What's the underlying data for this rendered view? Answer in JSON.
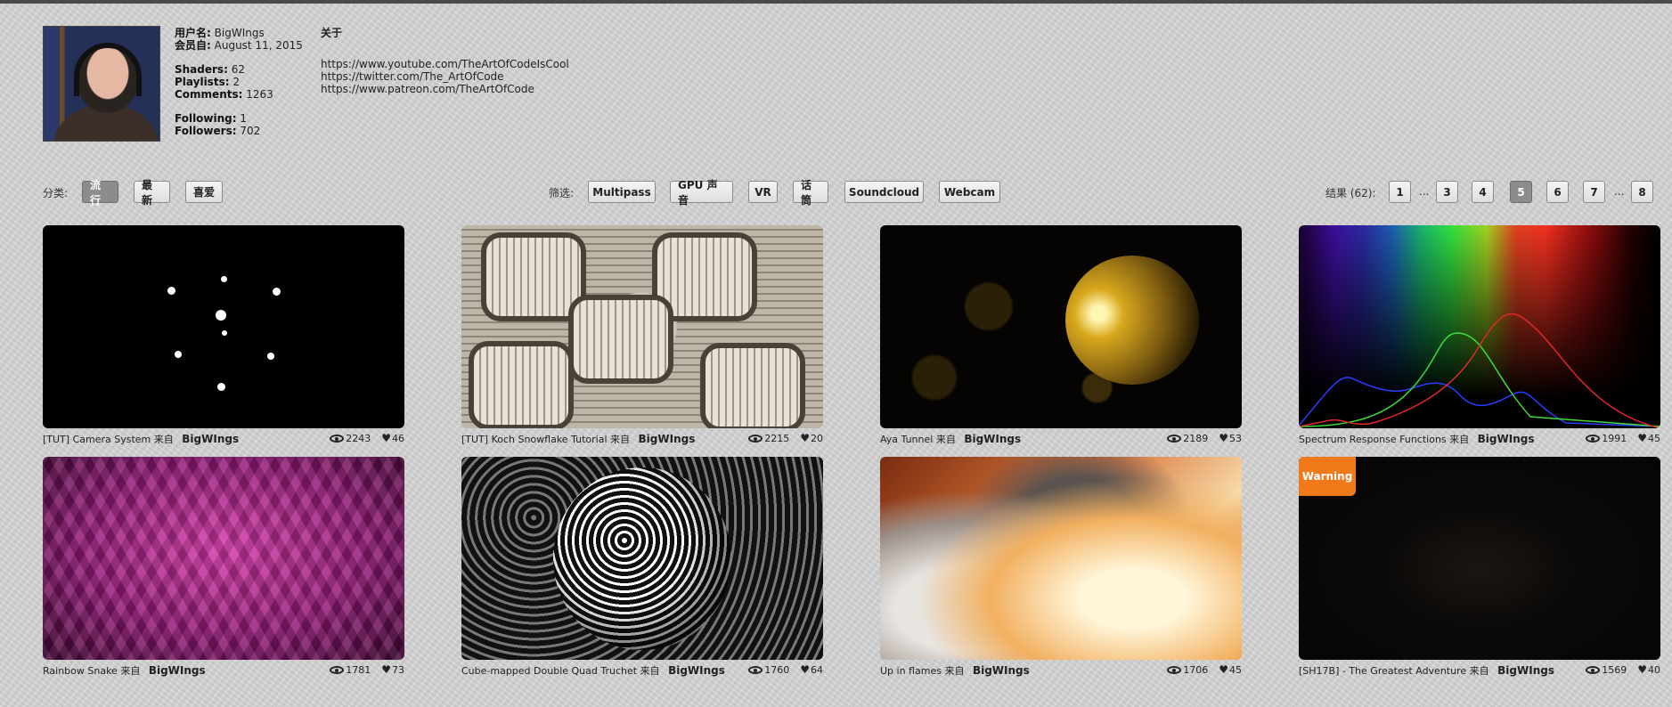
{
  "profile": {
    "username_label": "用户名:",
    "username": "BigWIngs",
    "member_label": "会员自:",
    "member_since": "August 11, 2015",
    "shaders_label": "Shaders:",
    "shaders": "62",
    "playlists_label": "Playlists:",
    "playlists": "2",
    "comments_label": "Comments:",
    "comments": "1263",
    "following_label": "Following:",
    "following": "1",
    "followers_label": "Followers:",
    "followers": "702"
  },
  "about": {
    "title": "关于",
    "links": [
      "https://www.youtube.com/TheArtOfCodeIsCool",
      "https://twitter.com/The_ArtOfCode",
      "https://www.patreon.com/TheArtOfCode"
    ]
  },
  "sort": {
    "label": "分类:",
    "options": [
      "流行",
      "最新",
      "喜爱"
    ],
    "active": "流行"
  },
  "filter": {
    "label": "筛选:",
    "options": [
      "Multipass",
      "GPU 声音",
      "VR",
      "话筒",
      "Soundcloud",
      "Webcam"
    ]
  },
  "pagination": {
    "results_label": "结果 (62):",
    "pages": [
      "1",
      "...",
      "3",
      "4",
      "5",
      "6",
      "7",
      "...",
      "8"
    ],
    "current": "5"
  },
  "by_label": "来自",
  "shaders": [
    {
      "title": "[TUT] Camera System",
      "author": "BigWIngs",
      "views": "2243",
      "likes": "46"
    },
    {
      "title": "[TUT] Koch Snowflake Tutorial",
      "author": "BigWIngs",
      "views": "2215",
      "likes": "20"
    },
    {
      "title": "Aya Tunnel",
      "author": "BigWIngs",
      "views": "2189",
      "likes": "53"
    },
    {
      "title": "Spectrum Response Functions",
      "author": "BigWIngs",
      "views": "1991",
      "likes": "45"
    },
    {
      "title": "Rainbow Snake",
      "author": "BigWIngs",
      "views": "1781",
      "likes": "73"
    },
    {
      "title": "Cube-mapped Double Quad Truchet",
      "author": "BigWIngs",
      "views": "1760",
      "likes": "64"
    },
    {
      "title": "Up in flames",
      "author": "BigWIngs",
      "views": "1706",
      "likes": "45"
    },
    {
      "title": "[SH17B] - The Greatest Adventure",
      "author": "BigWIngs",
      "views": "1569",
      "likes": "40",
      "badge": "Warning"
    }
  ]
}
